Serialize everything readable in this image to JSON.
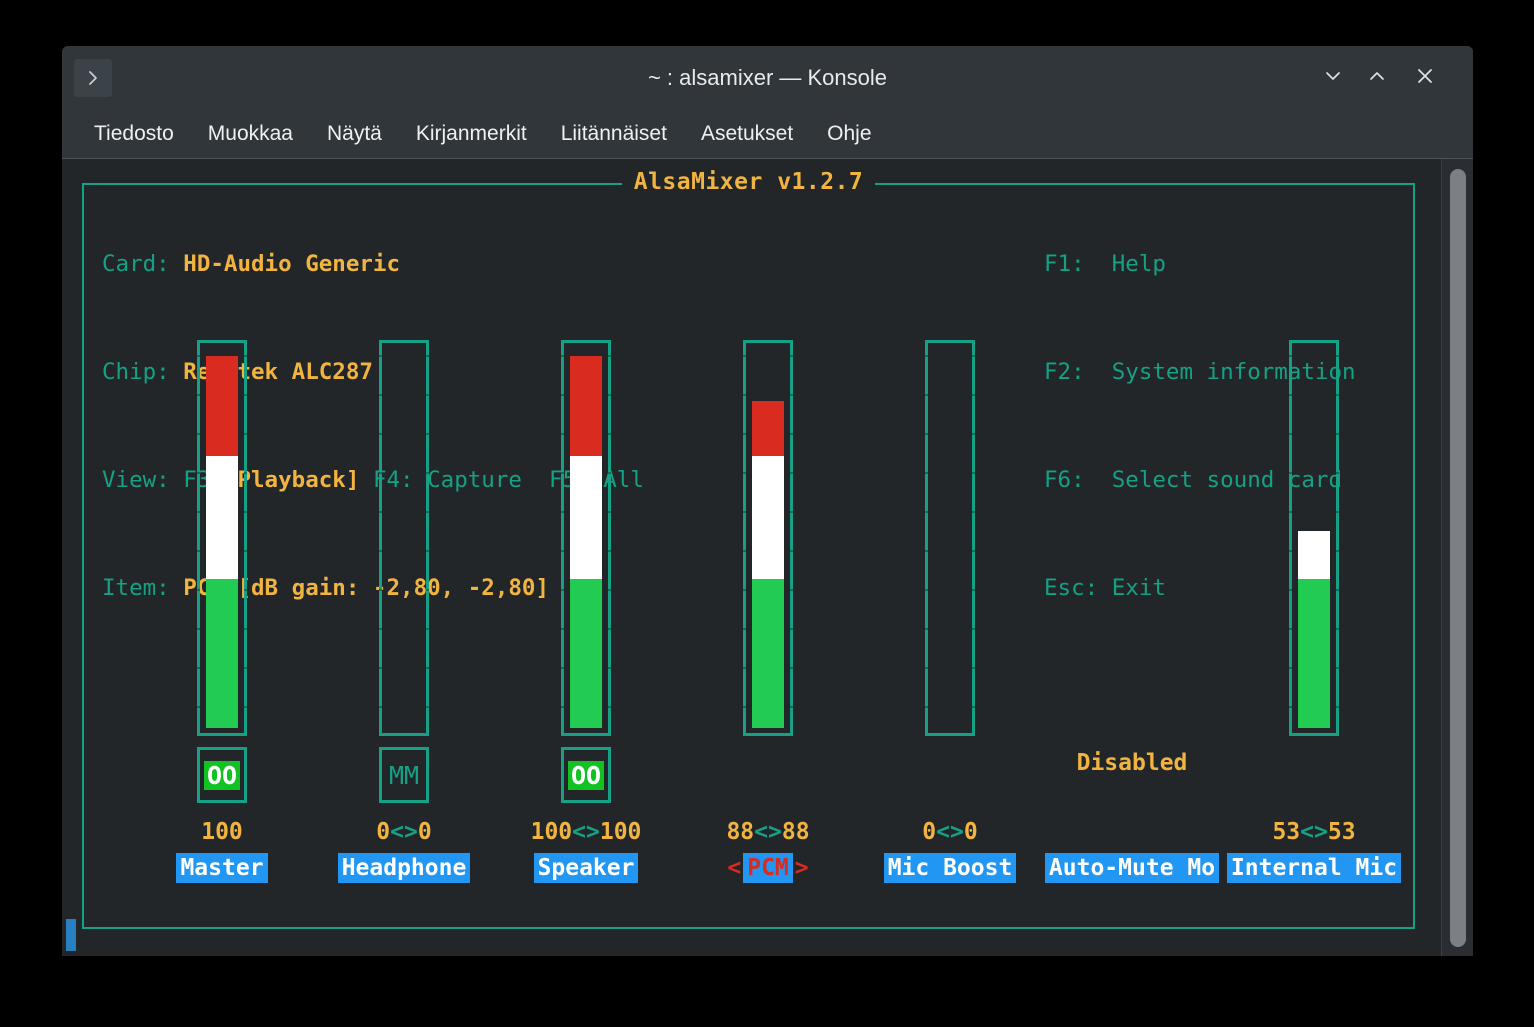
{
  "window": {
    "title": "~ : alsamixer — Konsole",
    "tab_button_icon": "chevron-right-icon",
    "controls": {
      "minimize": "minimize-icon",
      "maximize": "maximize-icon",
      "close": "close-icon"
    }
  },
  "menubar": {
    "items": [
      "Tiedosto",
      "Muokkaa",
      "Näytä",
      "Kirjanmerkit",
      "Liitännäiset",
      "Asetukset",
      "Ohje"
    ]
  },
  "alsamixer": {
    "panel_title": "AlsaMixer v1.2.7",
    "info": {
      "card_label": "Card:",
      "card_value": "HD-Audio Generic",
      "chip_label": "Chip:",
      "chip_value": "Realtek ALC287",
      "view_label": "View:",
      "view_f3": "F3:",
      "view_f3_value": "[Playback]",
      "view_f4": "F4: Capture",
      "view_f5": "F5: All",
      "item_label": "Item:",
      "item_value": "PCM [dB gain: -2,80, -2,80]"
    },
    "help": [
      {
        "key": "F1:",
        "action": "Help"
      },
      {
        "key": "F2:",
        "action": "System information"
      },
      {
        "key": "F6:",
        "action": "Select sound card"
      },
      {
        "key": "Esc:",
        "action": "Exit"
      }
    ],
    "colors": {
      "frame": "#16a085",
      "accent": "#f2b441",
      "green": "#22cc52",
      "white": "#ffffff",
      "red": "#d92b20",
      "label_bg": "#2196f3",
      "terminal_bg": "#232629"
    },
    "selected_channel": "PCM",
    "left_arrow": "<",
    "right_arrow": ">",
    "disabled_text": "Disabled",
    "channels": [
      {
        "name": "Master",
        "value_text": "100",
        "value": 100,
        "has_bar": true,
        "green_pct": 40,
        "white_pct": 33,
        "red_pct": 27,
        "mute": "OO",
        "muted": false,
        "selected": false,
        "disabled": false
      },
      {
        "name": "Headphone",
        "value_text": "0<>0",
        "value": 0,
        "has_bar": true,
        "green_pct": 0,
        "white_pct": 0,
        "red_pct": 0,
        "mute": "MM",
        "muted": true,
        "selected": false,
        "disabled": false
      },
      {
        "name": "Speaker",
        "value_text": "100<>100",
        "value": 100,
        "has_bar": true,
        "green_pct": 40,
        "white_pct": 33,
        "red_pct": 27,
        "mute": "OO",
        "muted": false,
        "selected": false,
        "disabled": false
      },
      {
        "name": "PCM",
        "value_text": "88<>88",
        "value": 88,
        "has_bar": true,
        "green_pct": 40,
        "white_pct": 33,
        "red_pct": 15,
        "mute": null,
        "muted": false,
        "selected": true,
        "disabled": false
      },
      {
        "name": "Mic Boost",
        "value_text": "0<>0",
        "value": 0,
        "has_bar": true,
        "green_pct": 0,
        "white_pct": 0,
        "red_pct": 0,
        "mute": null,
        "muted": false,
        "selected": false,
        "disabled": false
      },
      {
        "name": "Auto-Mute Mo",
        "value_text": "",
        "value": null,
        "has_bar": false,
        "green_pct": 0,
        "white_pct": 0,
        "red_pct": 0,
        "mute": null,
        "muted": false,
        "selected": false,
        "disabled": true
      },
      {
        "name": "Internal Mic",
        "value_text": "53<>53",
        "value": 53,
        "has_bar": true,
        "green_pct": 40,
        "white_pct": 13,
        "red_pct": 0,
        "mute": null,
        "muted": false,
        "selected": false,
        "disabled": false
      }
    ]
  }
}
